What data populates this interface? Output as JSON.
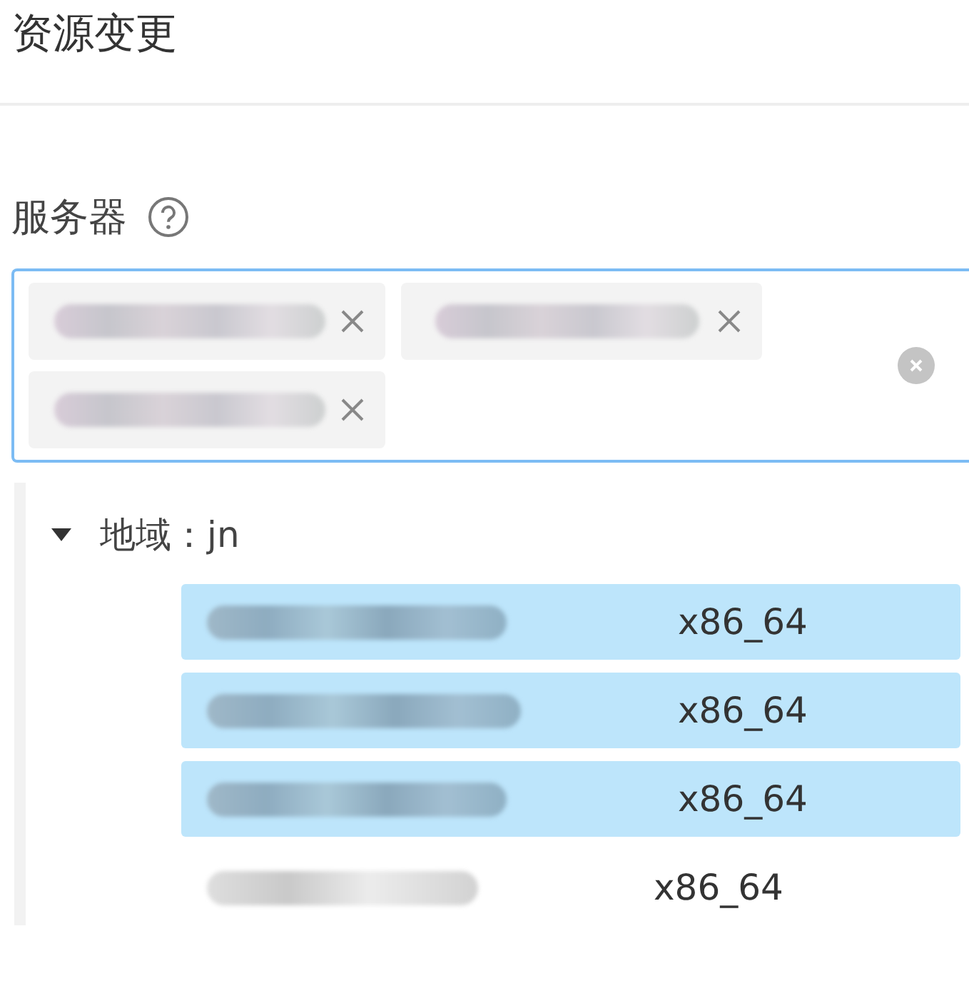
{
  "title": "资源变更",
  "field": {
    "label": "服务器",
    "help": true,
    "clearable": true,
    "tags": [
      {
        "removable": true
      },
      {
        "removable": true
      },
      {
        "removable": true
      }
    ]
  },
  "dropdown": {
    "group": {
      "label": "地域：jn",
      "expanded": true,
      "children": [
        {
          "arch": "x86_64",
          "selected": true
        },
        {
          "arch": "x86_64",
          "selected": true
        },
        {
          "arch": "x86_64",
          "selected": true
        },
        {
          "arch": "x86_64",
          "selected": false
        }
      ]
    }
  }
}
